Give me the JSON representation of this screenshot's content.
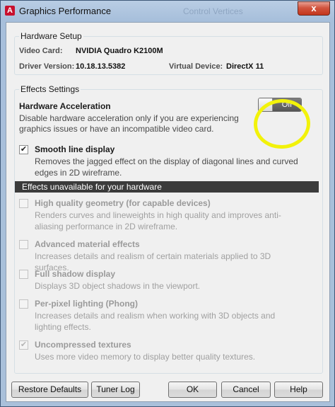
{
  "window": {
    "title": "Graphics Performance",
    "background_title": "Control Vertices",
    "close_label": "x"
  },
  "hardware_setup": {
    "legend": "Hardware Setup",
    "video_card_label": "Video Card:",
    "video_card_value": "NVIDIA Quadro K2100M",
    "driver_version_label": "Driver Version:",
    "driver_version_value": "10.18.13.5382",
    "virtual_device_label": "Virtual Device:",
    "virtual_device_value": "DirectX 11"
  },
  "effects_settings": {
    "legend": "Effects Settings",
    "hardware_acceleration_title": "Hardware Acceleration",
    "hardware_acceleration_desc": "Disable hardware acceleration only if you are experiencing graphics issues or have an incompatible video card.",
    "toggle_label": "Off",
    "toggle_state": "off",
    "smooth_line": {
      "title": "Smooth line display",
      "desc": "Removes the jagged effect on the display of diagonal lines and curved edges in 2D wireframe.",
      "checked": true
    },
    "unavailable_header": "Effects unavailable for your hardware",
    "unavailable_effects": [
      {
        "title": "High quality geometry (for capable devices)",
        "desc": "Renders curves and lineweights in high quality and improves anti-aliasing performance in 2D wireframe.",
        "checked": false
      },
      {
        "title": "Advanced material effects",
        "desc": "Increases details and realism of certain materials applied to 3D surfaces.",
        "checked": false
      },
      {
        "title": "Full shadow display",
        "desc": "Displays 3D object shadows in the viewport.",
        "checked": false
      },
      {
        "title": "Per-pixel lighting (Phong)",
        "desc": "Increases details and realism when working with 3D objects and lighting effects.",
        "checked": false
      },
      {
        "title": "Uncompressed textures",
        "desc": "Uses more video memory to display better quality textures.",
        "checked": true
      }
    ]
  },
  "buttons": {
    "restore_defaults": "Restore Defaults",
    "tuner_log": "Tuner Log",
    "ok": "OK",
    "cancel": "Cancel",
    "help": "Help"
  },
  "colors": {
    "highlight": "#f2f20a",
    "toggle_off": "#5e5e5e",
    "unavailable_bar": "#3b3b3b"
  }
}
